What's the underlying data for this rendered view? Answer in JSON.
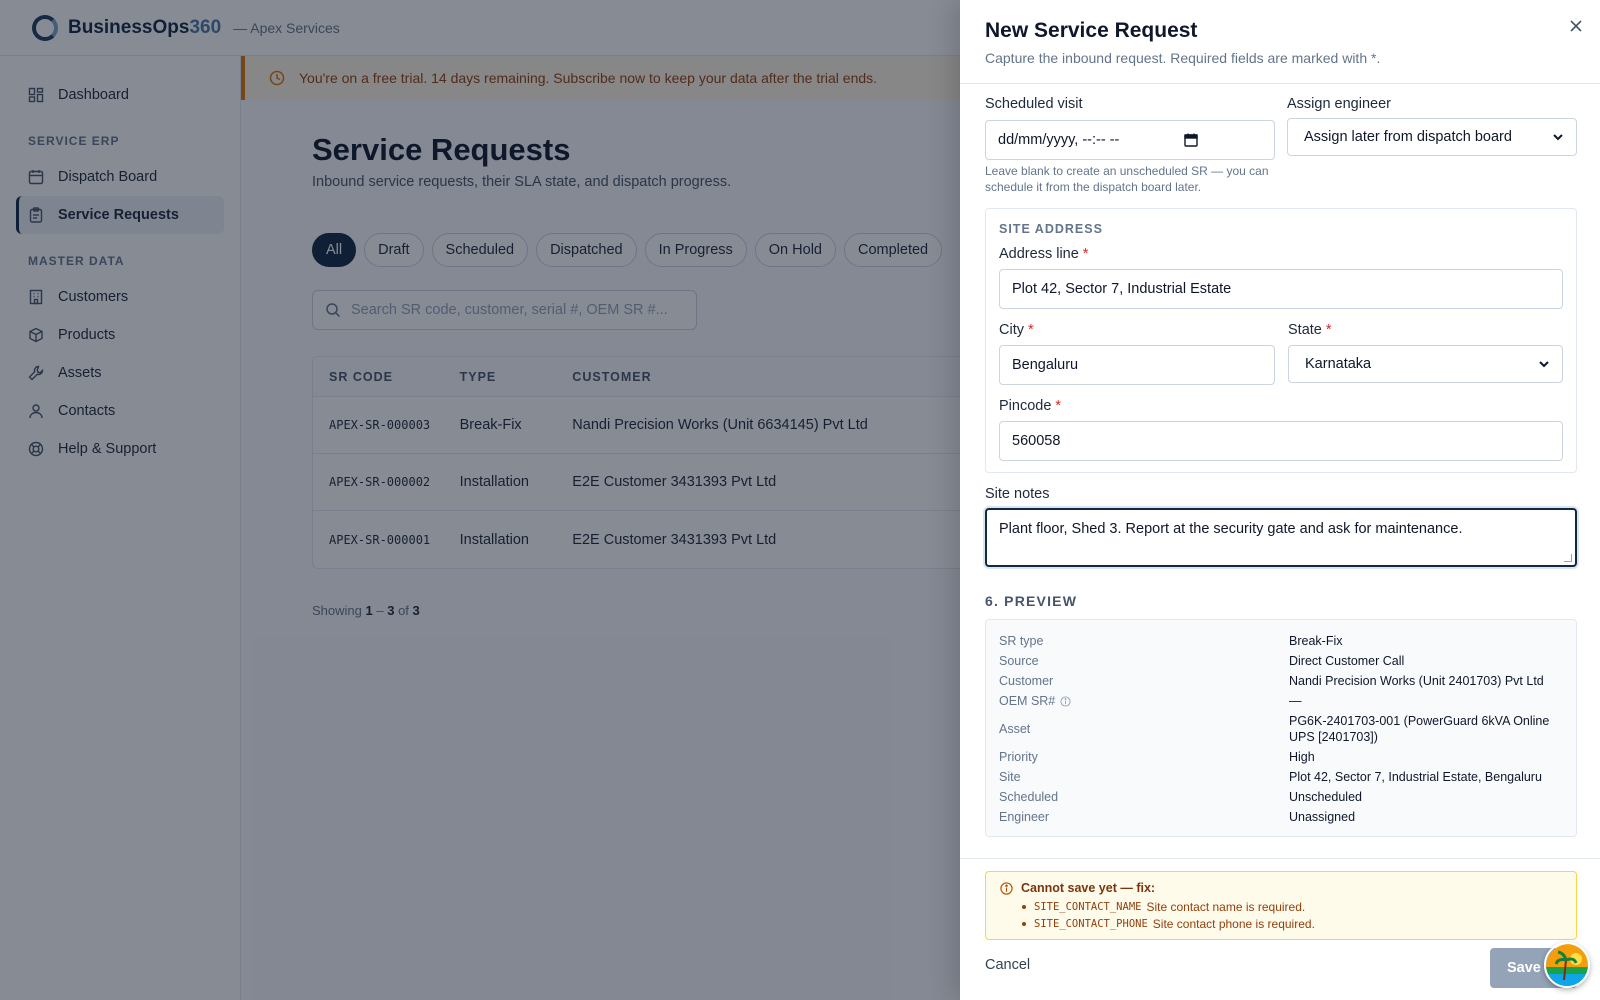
{
  "app": {
    "brand_name": "BusinessOps",
    "brand_num": "360",
    "tenant": "— Apex Services"
  },
  "sidebar": {
    "items_top": [
      {
        "label": "Dashboard",
        "icon": "dashboard-icon"
      }
    ],
    "section_service": "SERVICE ERP",
    "items_service": [
      {
        "label": "Dispatch Board",
        "icon": "calendar-icon"
      },
      {
        "label": "Service Requests",
        "icon": "clipboard-icon",
        "active": true
      }
    ],
    "section_master": "MASTER DATA",
    "items_master": [
      {
        "label": "Customers",
        "icon": "building-icon"
      },
      {
        "label": "Products",
        "icon": "box-icon"
      },
      {
        "label": "Assets",
        "icon": "wrench-icon"
      },
      {
        "label": "Contacts",
        "icon": "user-icon"
      },
      {
        "label": "Help & Support",
        "icon": "lifebuoy-icon"
      }
    ]
  },
  "trial": {
    "text": "You're on a free trial. 14 days remaining. Subscribe now to keep your data after the trial ends."
  },
  "page": {
    "title": "Service Requests",
    "subtitle": "Inbound service requests, their SLA state, and dispatch progress.",
    "filters": [
      "All",
      "Draft",
      "Scheduled",
      "Dispatched",
      "In Progress",
      "On Hold",
      "Completed"
    ],
    "search_placeholder": "Search SR code, customer, serial #, OEM SR #...",
    "table": {
      "headers": [
        "SR CODE",
        "TYPE",
        "CUSTOMER"
      ],
      "rows": [
        [
          "APEX-SR-000003",
          "Break-Fix",
          "Nandi Precision Works (Unit 6634145) Pvt Ltd"
        ],
        [
          "APEX-SR-000002",
          "Installation",
          "E2E Customer 3431393 Pvt Ltd"
        ],
        [
          "APEX-SR-000001",
          "Installation",
          "E2E Customer 3431393 Pvt Ltd"
        ]
      ]
    },
    "showing": {
      "prefix": "Showing",
      "from": "1",
      "dash": "–",
      "to": "3",
      "of": "of",
      "total": "3"
    }
  },
  "drawer": {
    "title": "New Service Request",
    "subtitle": "Capture the inbound request. Required fields are marked with *.",
    "scheduled_visit": {
      "label": "Scheduled visit",
      "value": "dd/mm/yyyy, --:-- --",
      "help": "Leave blank to create an unscheduled SR — you can schedule it from the dispatch board later."
    },
    "assign_engineer": {
      "label": "Assign engineer",
      "value": "Assign later from dispatch board"
    },
    "site_address": {
      "caption": "SITE ADDRESS",
      "address_line": {
        "label": "Address line",
        "value": "Plot 42, Sector 7, Industrial Estate"
      },
      "city": {
        "label": "City",
        "value": "Bengaluru"
      },
      "state": {
        "label": "State",
        "value": "Karnataka"
      },
      "pincode": {
        "label": "Pincode",
        "value": "560058"
      },
      "required_mark": "*"
    },
    "site_notes": {
      "label": "Site notes",
      "value": "Plant floor, Shed 3. Report at the security gate and ask for maintenance."
    },
    "preview": {
      "title": "6. PREVIEW",
      "rows": [
        {
          "key": "SR type",
          "value": "Break-Fix"
        },
        {
          "key": "Source",
          "value": "Direct Customer Call"
        },
        {
          "key": "Customer",
          "value": "Nandi Precision Works (Unit 2401703) Pvt Ltd"
        },
        {
          "key": "OEM SR#",
          "value": "—"
        },
        {
          "key": "Asset",
          "value": "PG6K-2401703-001 (PowerGuard 6kVA Online UPS [2401703])"
        },
        {
          "key": "Priority",
          "value": "High"
        },
        {
          "key": "Site",
          "value": "Plot 42, Sector 7, Industrial Estate, Bengaluru"
        },
        {
          "key": "Scheduled",
          "value": "Unscheduled"
        },
        {
          "key": "Engineer",
          "value": "Unassigned"
        }
      ]
    },
    "errors": {
      "title": "Cannot save yet — fix:",
      "items": [
        {
          "code": "SITE_CONTACT_NAME",
          "message": "Site contact name is required."
        },
        {
          "code": "SITE_CONTACT_PHONE",
          "message": "Site contact phone is required."
        }
      ]
    },
    "cancel_label": "Cancel",
    "save_label": "Save"
  },
  "colors": {
    "brand": "#0f2942",
    "accent": "#4a78a8",
    "warning": "#d97706",
    "error": "#dc2626"
  }
}
